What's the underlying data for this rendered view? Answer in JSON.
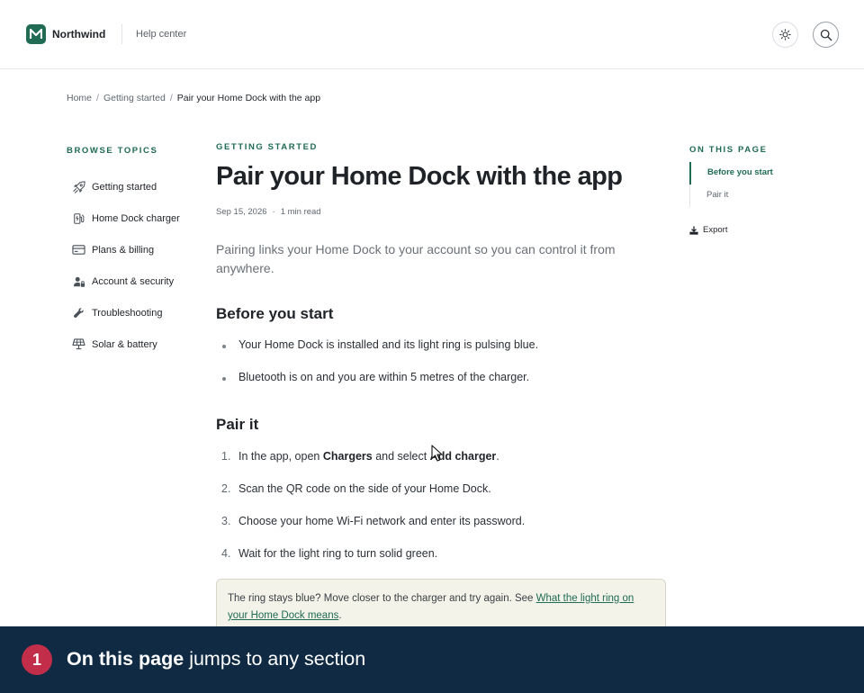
{
  "header": {
    "logo_letter": "M",
    "brand": "Northwind",
    "section": "Help center",
    "icons": [
      "sun-icon",
      "search-icon"
    ]
  },
  "breadcrumb": {
    "items": [
      "Home",
      "Getting started"
    ],
    "current": "Pair your Home Dock with the app"
  },
  "sidebar": {
    "title": "BROWSE TOPICS",
    "items": [
      {
        "label": "Getting started",
        "icon": "rocket-icon"
      },
      {
        "label": "Home Dock charger",
        "icon": "ev-charger-icon"
      },
      {
        "label": "Plans & billing",
        "icon": "credit-card-icon"
      },
      {
        "label": "Account & security",
        "icon": "user-lock-icon"
      },
      {
        "label": "Troubleshooting",
        "icon": "wrench-icon"
      },
      {
        "label": "Solar & battery",
        "icon": "solar-panel-icon"
      }
    ]
  },
  "article": {
    "eyebrow": "GETTING STARTED",
    "title": "Pair your Home Dock with the app",
    "date": "Sep 15, 2026",
    "read_time": "1 min read",
    "lead": "Pairing links your Home Dock to your account so you can control it from anywhere.",
    "before_heading": "Before you start",
    "before_items": [
      "Your Home Dock is installed and its light ring is pulsing blue.",
      "Bluetooth is on and you are within 5 metres of the charger."
    ],
    "pair_heading": "Pair it",
    "steps": {
      "s1_pre": "In the app, open ",
      "s1_b1": "Chargers",
      "s1_mid": " and select ",
      "s1_b2": "Add charger",
      "s1_post": ".",
      "s2": "Scan the QR code on the side of your Home Dock.",
      "s3": "Choose your home Wi-Fi network and enter its password.",
      "s4": "Wait for the light ring to turn solid green."
    },
    "callout": {
      "text": "The ring stays blue? Move closer to the charger and try again. See ",
      "link": "What the light ring on your Home Dock means",
      "end": "."
    }
  },
  "toc": {
    "title": "ON THIS PAGE",
    "items": [
      "Before you start",
      "Pair it"
    ],
    "active_index": 0,
    "export_label": "Export"
  },
  "banner": {
    "step": "1",
    "bold": "On this page",
    "rest": " jumps to any section"
  },
  "colors": {
    "accent": "#1f6b54",
    "banner_bg": "#102a43",
    "badge": "#c22e4a",
    "callout_bg": "#f4f3ea"
  }
}
